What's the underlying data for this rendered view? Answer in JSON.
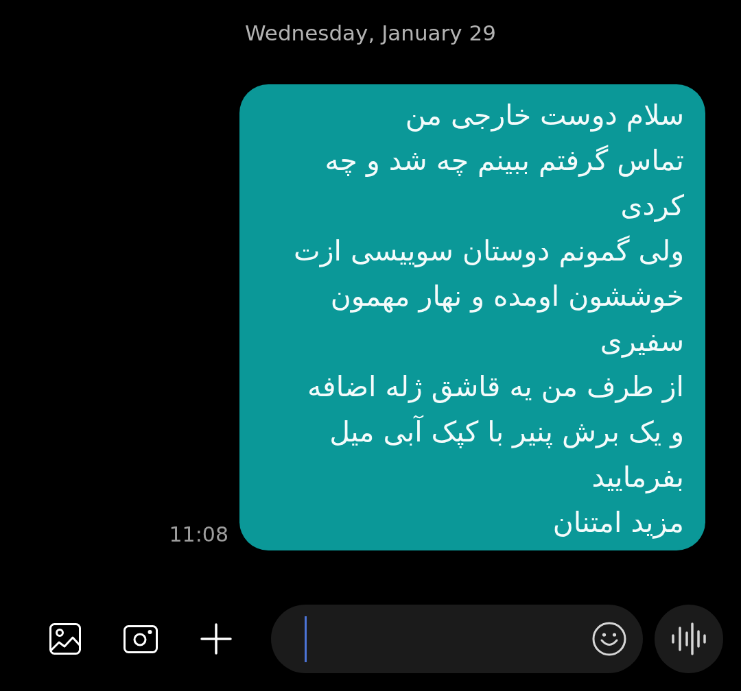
{
  "date_header": "Wednesday, January 29",
  "messages": [
    {
      "kind": "outgoing",
      "text": "سلام دوست خارجی من\nتماس گرفتم ببینم چه شد و چه\nکردی\nولی گمونم دوستان سوییسی ازت\nخوششون اومده و نهار مهمون\nسفیری\nاز طرف من یه قاشق ژله اضافه\nو یک برش پنیر با کپک آبی میل\nبفرمایید\nمزید امتنان",
      "time": "11:08"
    }
  ],
  "composer": {
    "left_buttons": [
      {
        "kind": "gallery"
      },
      {
        "kind": "camera"
      },
      {
        "kind": "add"
      }
    ],
    "input": {
      "focused": true,
      "button": {
        "kind": "emoji"
      }
    },
    "right_button": {
      "kind": "voice"
    }
  }
}
